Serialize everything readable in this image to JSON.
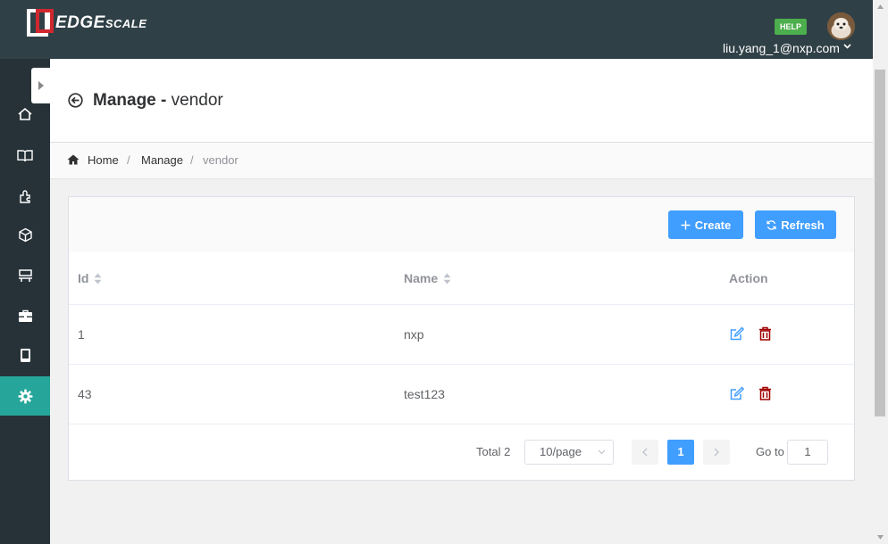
{
  "brand": {
    "name_main": "EDGE",
    "name_small": "SCALE"
  },
  "header": {
    "help_label": "HELP",
    "user_email": "liu.yang_1@nxp.com"
  },
  "sidebar": {
    "items": [
      {
        "icon": "home-icon",
        "active": false
      },
      {
        "icon": "book-icon",
        "active": false
      },
      {
        "icon": "puzzle-icon",
        "active": false
      },
      {
        "icon": "cube-icon",
        "active": false
      },
      {
        "icon": "device-stack-icon",
        "active": false
      },
      {
        "icon": "toolbox-icon",
        "active": false
      },
      {
        "icon": "tablet-icon",
        "active": false
      },
      {
        "icon": "gear-icon",
        "active": true
      }
    ]
  },
  "page": {
    "title_bold": "Manage -",
    "title_rest": "vendor"
  },
  "breadcrumb": {
    "items": [
      "Home",
      "Manage",
      "vendor"
    ],
    "separator": "/"
  },
  "toolbar": {
    "create_label": "Create",
    "refresh_label": "Refresh"
  },
  "table": {
    "columns": [
      "Id",
      "Name",
      "Action"
    ],
    "rows": [
      {
        "id": "1",
        "name": "nxp"
      },
      {
        "id": "43",
        "name": "test123"
      }
    ]
  },
  "pagination": {
    "total_label": "Total 2",
    "page_size": "10/page",
    "current_page": "1",
    "goto_label": "Go to",
    "goto_value": "1"
  },
  "colors": {
    "topbar": "#304047",
    "sidebar": "#263238",
    "active": "#26a69a",
    "primary": "#409eff",
    "danger": "#a00000"
  }
}
